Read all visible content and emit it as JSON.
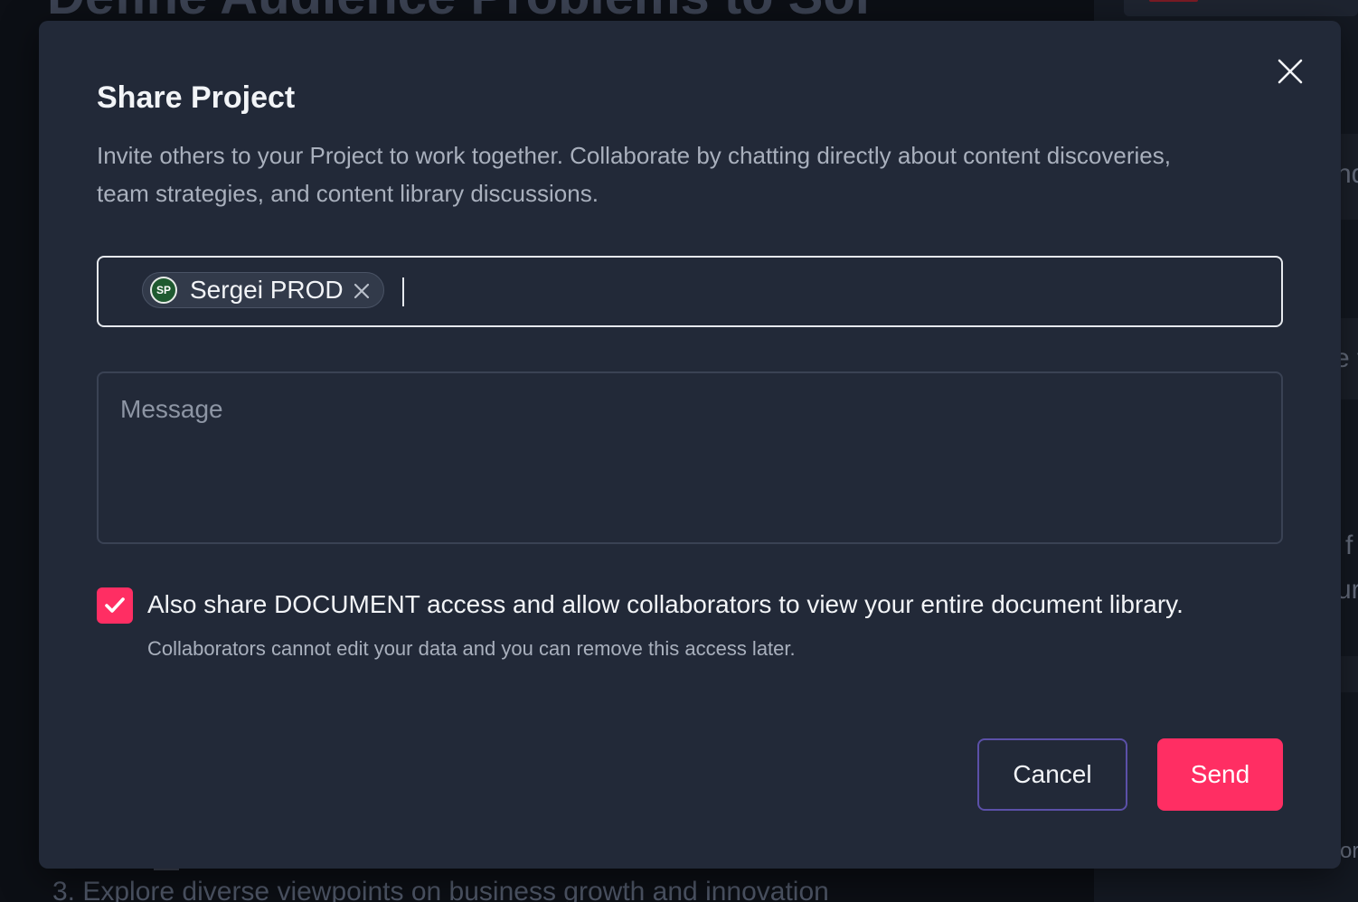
{
  "background": {
    "heading_fragment": "Define Audience Problems to Sol",
    "list_item_fragment": "3. Explore diverse viewpoints on business growth and innovation",
    "right_fragments": [
      "nd",
      "e f",
      "f",
      "ur",
      "or"
    ]
  },
  "modal": {
    "title": "Share Project",
    "description": "Invite others to your Project to work together. Collaborate by chatting directly about content discoveries, team strategies, and content library discussions.",
    "recipients": [
      {
        "initials": "SP",
        "name": "Sergei PROD"
      }
    ],
    "message_placeholder": "Message",
    "message_value": "",
    "share_documents": {
      "checked": true,
      "label": "Also share DOCUMENT access and allow collaborators to view your entire document library.",
      "sublabel": "Collaborators cannot edit your data and you can remove this access later."
    },
    "buttons": {
      "cancel": "Cancel",
      "send": "Send"
    }
  },
  "colors": {
    "accent": "#ff2e63",
    "modal_bg": "#222938",
    "backdrop": "#0c0f15",
    "cancel_border": "#5b50a8",
    "avatar_bg": "#1f5a30"
  },
  "icons": {
    "close": "close-icon",
    "chip_remove": "close-icon",
    "checkbox": "checkmark-icon"
  }
}
